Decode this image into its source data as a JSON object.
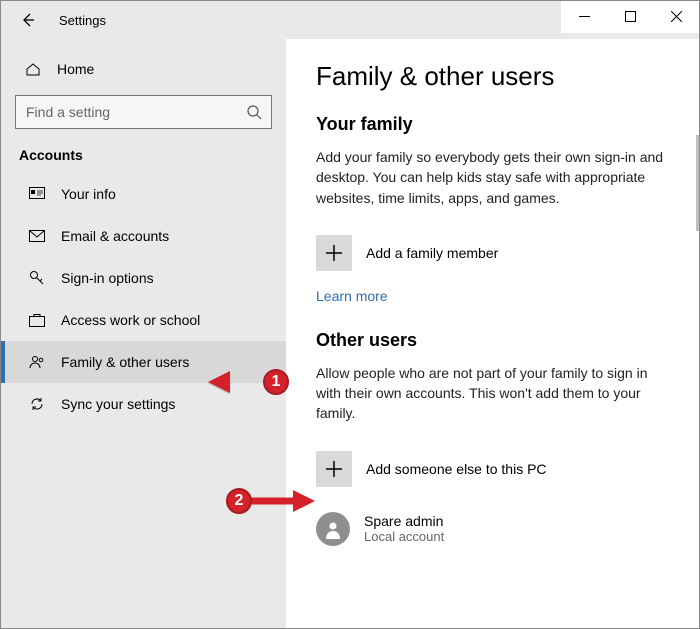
{
  "window": {
    "title": "Settings"
  },
  "sidebar": {
    "home_label": "Home",
    "search_placeholder": "Find a setting",
    "category": "Accounts",
    "items": [
      {
        "label": "Your info"
      },
      {
        "label": "Email & accounts"
      },
      {
        "label": "Sign-in options"
      },
      {
        "label": "Access work or school"
      },
      {
        "label": "Family & other users"
      },
      {
        "label": "Sync your settings"
      }
    ]
  },
  "main": {
    "heading": "Family & other users",
    "family": {
      "title": "Your family",
      "desc": "Add your family so everybody gets their own sign-in and desktop. You can help kids stay safe with appropriate websites, time limits, apps, and games.",
      "add_label": "Add a family member",
      "learn_more": "Learn more"
    },
    "other": {
      "title": "Other users",
      "desc": "Allow people who are not part of your family to sign in with their own accounts. This won't add them to your family.",
      "add_label": "Add someone else to this PC",
      "user": {
        "name": "Spare admin",
        "sub": "Local account"
      }
    }
  },
  "annotations": {
    "n1": "1",
    "n2": "2"
  }
}
